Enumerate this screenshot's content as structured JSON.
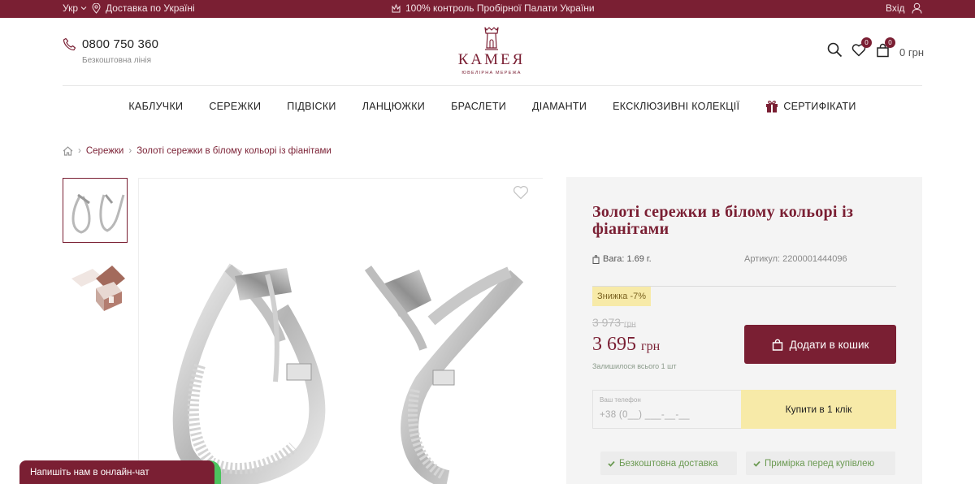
{
  "topbar": {
    "language": "Укр",
    "delivery": "Доставка по Україні",
    "quality_control": "100% контроль Пробірної Палати України",
    "login": "Вхід"
  },
  "header": {
    "phone": "0800 750 360",
    "phone_note": "Безкоштовна лінія",
    "logo_name": "КАМЕЯ",
    "logo_tagline": "ЮВЕЛІРНА МЕРЕЖА",
    "favorites_count": "0",
    "cart_count": "0",
    "cart_total": "0 грн"
  },
  "nav": {
    "items": [
      "КАБЛУЧКИ",
      "СЕРЕЖКИ",
      "ПІДВІСКИ",
      "ЛАНЦЮЖКИ",
      "БРАСЛЕТИ",
      "ДІАМАНТИ",
      "ЕКСКЛЮЗИВНІ КОЛЕКЦІЇ",
      "СЕРТИФІКАТИ"
    ]
  },
  "breadcrumb": {
    "category": "Сережки",
    "current": "Золоті сережки в білому кольорі із фіанітами"
  },
  "product": {
    "title": "Золоті сережки в білому кольорі із фіанітами",
    "weight": "Вага: 1.69 г.",
    "sku": "Артикул: 2200001444096",
    "discount": "Знижка -7%",
    "old_price": "3 973",
    "old_currency": "грн",
    "price": "3 695",
    "currency": "грн",
    "stock": "Залишилося всього 1 шт",
    "add_to_cart": "Додати в кошик",
    "oneclick_label": "Ваш телефон",
    "oneclick_placeholder": "+38 (0__) ___-__-__",
    "oneclick_button": "Купити в 1 клік",
    "perk_delivery": "Безкоштовна доставка",
    "perk_fitting": "Примірка перед купівлею"
  },
  "chat": {
    "label": "Напишіть нам в онлайн-чат"
  },
  "colors": {
    "brand": "#7a1f33",
    "discount_bg": "#f7eaa8",
    "perk_text": "#6b9a52",
    "chat_status": "#4cc35e"
  }
}
